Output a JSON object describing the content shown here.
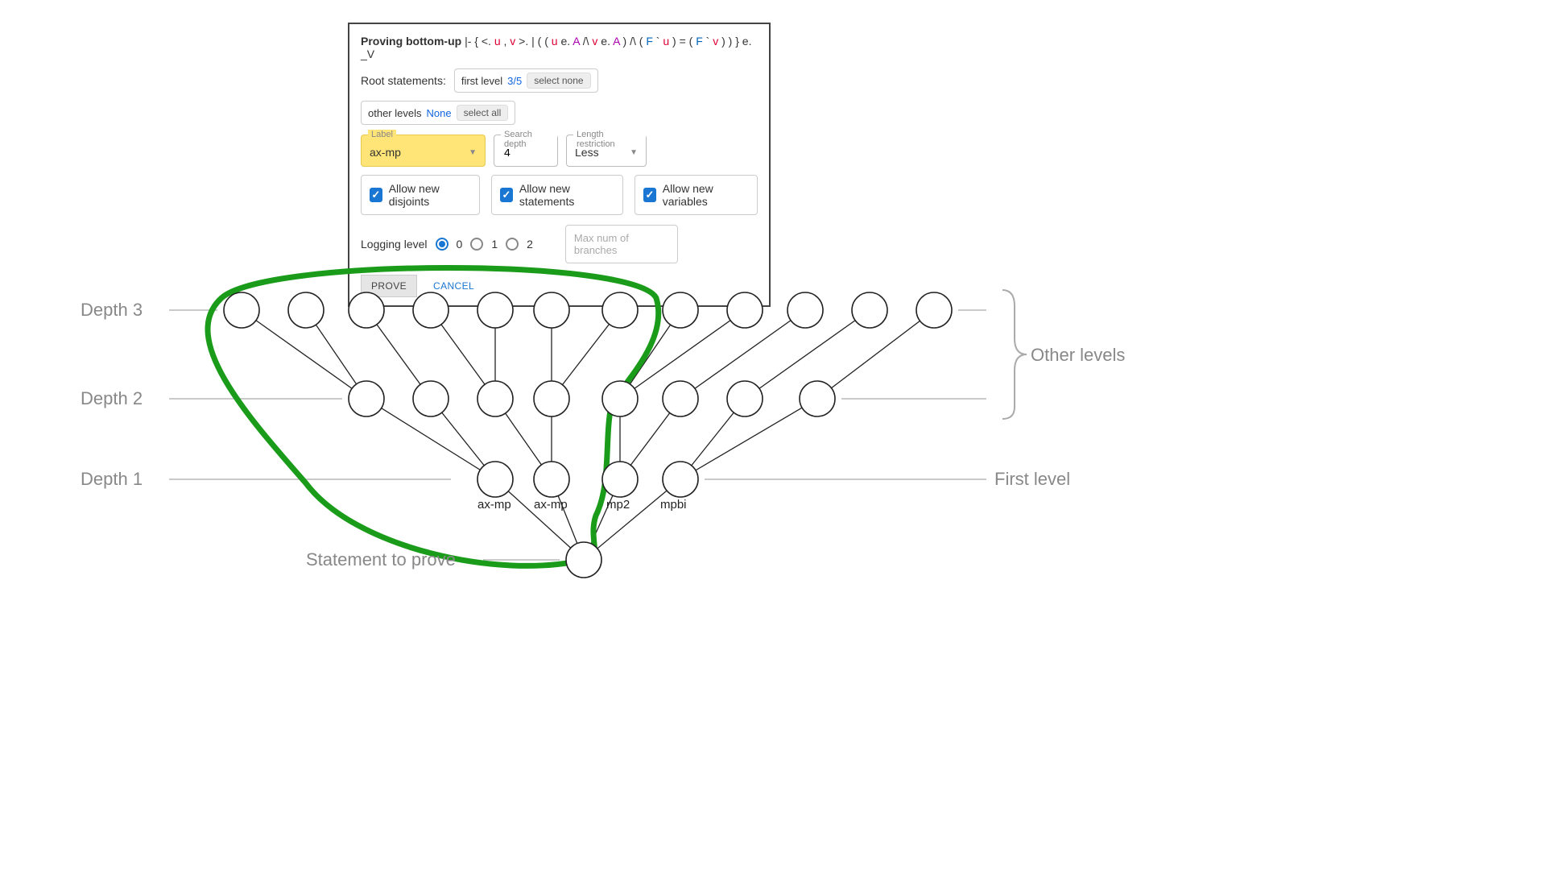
{
  "panel": {
    "title_prefix": "Proving bottom-up",
    "expr_plain": "|- { <. u , v >. | ( ( u e. A /\\ v e. A ) /\\ ( F ` u ) = ( F ` v ) ) } e. _V",
    "root_label": "Root statements:",
    "first_level_label": "first level",
    "first_level_count": "3/5",
    "select_none": "select none",
    "other_levels_label": "other levels",
    "other_levels_count": "None",
    "select_all": "select all",
    "field_label": "Label",
    "field_label_value": "ax-mp",
    "field_depth": "Search depth",
    "field_depth_value": "4",
    "field_len": "Length restriction",
    "field_len_value": "Less",
    "chk1": "Allow new disjoints",
    "chk2": "Allow new statements",
    "chk3": "Allow new variables",
    "log_label": "Logging level",
    "log_opts": [
      "0",
      "1",
      "2"
    ],
    "max_branches_ph": "Max num of branches",
    "prove": "PROVE",
    "cancel": "CANCEL"
  },
  "diagram": {
    "depth3": "Depth 3",
    "depth2": "Depth 2",
    "depth1": "Depth 1",
    "stmt": "Statement to prove",
    "first_level": "First level",
    "other_levels": "Other levels",
    "n1": "ax-mp",
    "n2": "ax-mp",
    "n3": "mp2",
    "n4": "mpbi"
  }
}
